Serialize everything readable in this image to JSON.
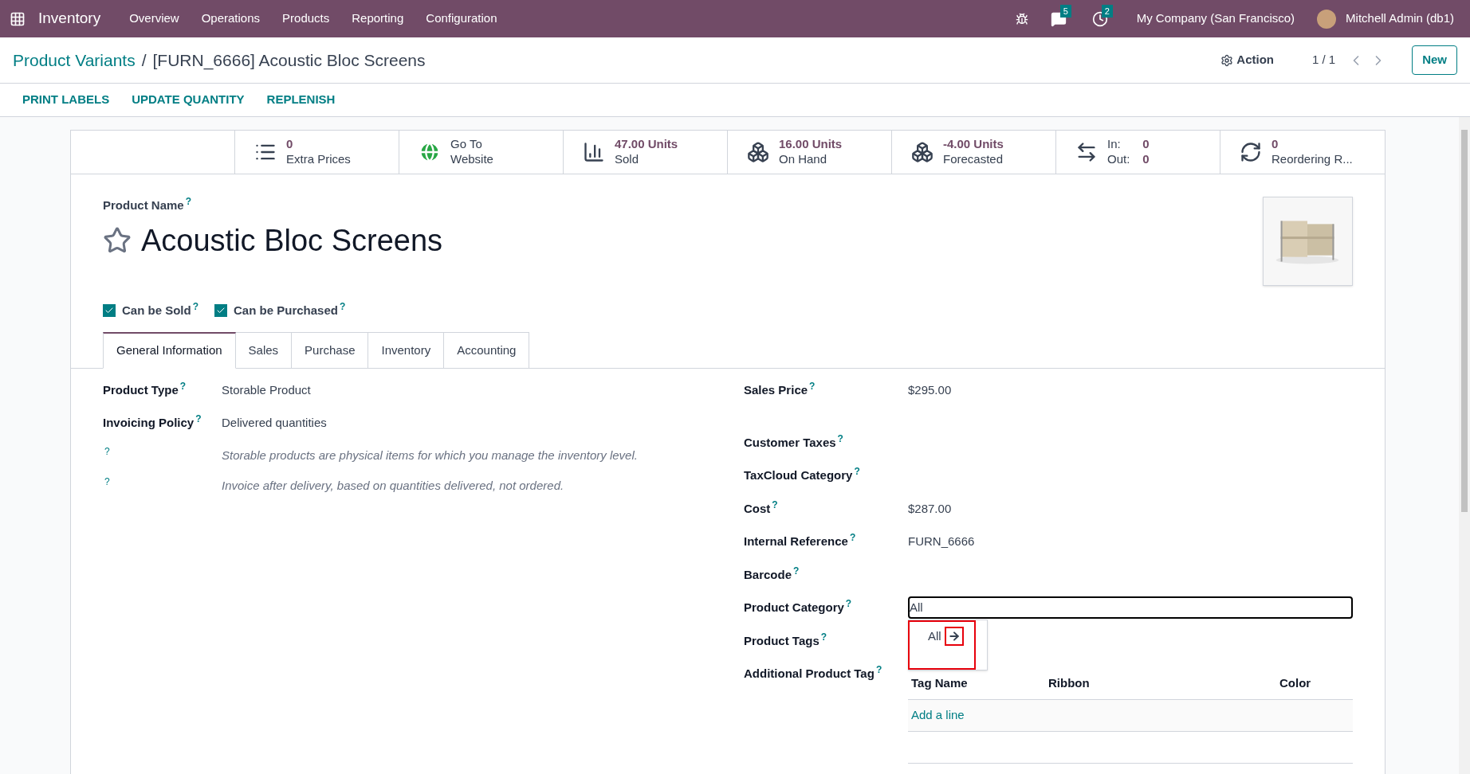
{
  "navbar": {
    "app": "Inventory",
    "menu": [
      "Overview",
      "Operations",
      "Products",
      "Reporting",
      "Configuration"
    ],
    "messages_badge": "5",
    "activities_badge": "2",
    "company": "My Company (San Francisco)",
    "user": "Mitchell Admin (db1)"
  },
  "breadcrumb": {
    "parent": "Product Variants",
    "separator": "/",
    "current": "[FURN_6666] Acoustic Bloc Screens",
    "action": "Action",
    "pager": "1 / 1",
    "new_button": "New"
  },
  "actions": [
    "PRINT LABELS",
    "UPDATE QUANTITY",
    "REPLENISH"
  ],
  "stat_buttons": [
    {
      "kind": "list",
      "value": "0",
      "label": "Extra Prices"
    },
    {
      "kind": "globe",
      "value": "Go To",
      "label": "Website"
    },
    {
      "kind": "chart",
      "value": "47.00 Units",
      "label": "Sold"
    },
    {
      "kind": "boxes",
      "value": "16.00 Units",
      "label": "On Hand"
    },
    {
      "kind": "boxes",
      "value": "-4.00 Units",
      "label": "Forecasted"
    },
    {
      "kind": "inout",
      "in_label": "In:",
      "in_value": "0",
      "out_label": "Out:",
      "out_value": "0"
    },
    {
      "kind": "refresh",
      "value": "0",
      "label": "Reordering R..."
    }
  ],
  "form": {
    "name_label": "Product Name",
    "help": "?",
    "name": "Acoustic Bloc Screens",
    "favorite": false,
    "checkboxes": [
      {
        "label": "Can be Sold",
        "checked": true
      },
      {
        "label": "Can be Purchased",
        "checked": true
      }
    ],
    "tabs": [
      {
        "label": "General Information",
        "selected": true
      },
      {
        "label": "Sales",
        "selected": false
      },
      {
        "label": "Purchase",
        "selected": false
      },
      {
        "label": "Inventory",
        "selected": false
      },
      {
        "label": "Accounting",
        "selected": false
      }
    ],
    "left_fields": [
      {
        "label": "Product Type",
        "value": "Storable Product"
      },
      {
        "label": "Invoicing Policy",
        "value": "Delivered quantities"
      }
    ],
    "notes": [
      "Storable products are physical items for which you manage the inventory level.",
      "Invoice after delivery, based on quantities delivered, not ordered."
    ],
    "right_fields": [
      {
        "label": "Sales Price",
        "value": "$295.00"
      },
      {
        "label": "Customer Taxes"
      },
      {
        "label": "TaxCloud Category"
      },
      {
        "label": "Cost",
        "value": "$287.00"
      },
      {
        "label": "Internal Reference",
        "value": "FURN_6666"
      },
      {
        "label": "Barcode"
      },
      {
        "label": "Product Category",
        "input": "All"
      },
      {
        "label": "Product Tags"
      },
      {
        "label": "Additional Product Tag"
      }
    ],
    "category_dropdown": {
      "item": "All",
      "highlighted": true
    },
    "tag_table": {
      "columns": [
        "Tag Name",
        "Ribbon",
        "Color"
      ],
      "add_line": "Add a line"
    }
  }
}
